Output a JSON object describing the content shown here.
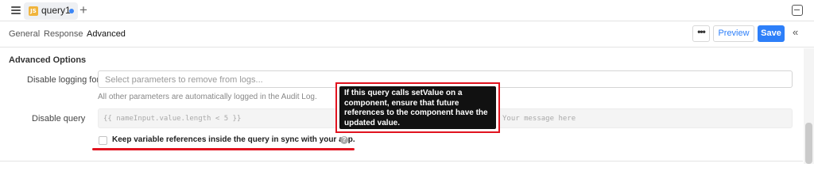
{
  "topbar": {
    "tab": {
      "badge": "JS",
      "label": "query1",
      "dot_color": "#3b86f7"
    },
    "add_tab": "+"
  },
  "subtabs": [
    "General",
    "Response",
    "Advanced"
  ],
  "active_subtab": "Advanced",
  "actions": {
    "more": "•••",
    "preview": "Preview",
    "save": "Save",
    "collapse": "«"
  },
  "advanced": {
    "section_title": "Advanced Options",
    "disable_logging": {
      "label": "Disable logging for",
      "placeholder": "Select parameters to remove from logs...",
      "help": "All other parameters are automatically logged in the Audit Log."
    },
    "disable_query": {
      "label": "Disable query",
      "placeholder": "{{ nameInput.value.length < 5 }}",
      "message_placeholder": "Your message here"
    },
    "sync": {
      "label": "Keep variable references inside the query in sync with your app.",
      "checked": false,
      "help_icon": "?"
    }
  },
  "tooltip": {
    "text": "If this query calls setValue on a component, ensure that future references to the component have the updated value."
  },
  "colors": {
    "accent": "#2d7ff9",
    "highlight": "#e1131f",
    "js_badge": "#f0b43c"
  }
}
